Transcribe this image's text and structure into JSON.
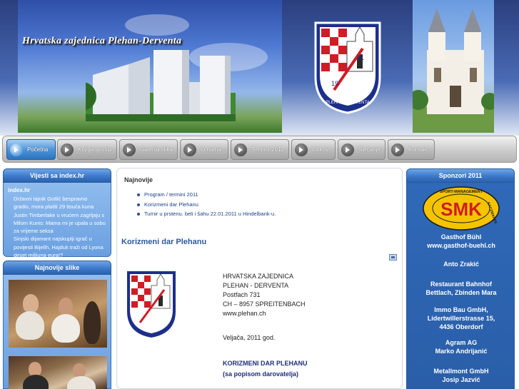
{
  "header": {
    "site_title": "Hrvatska zajednica Plehan-Derventa",
    "crest_year_left": "19",
    "crest_year_right": "91",
    "crest_text": "PLEHAN - DERVENTA"
  },
  "nav": {
    "items": [
      {
        "label": "Početna",
        "active": true
      },
      {
        "label": "Knjiga gostiju",
        "active": false
      },
      {
        "label": "Galerija slika",
        "active": false
      },
      {
        "label": "O nama",
        "active": false
      },
      {
        "label": "Termini 2011",
        "active": false
      },
      {
        "label": "Linkovi",
        "active": false
      },
      {
        "label": "Sjećanje",
        "active": false
      },
      {
        "label": "Kontakt",
        "active": false
      }
    ]
  },
  "left": {
    "news_title": "Vijesti sa index.hr",
    "news_source": "index.hr",
    "news_items": [
      "Državni tajnik Gotlić bespravno",
      "gradio, mora platiti 29 tisuća kuna",
      "Justin Timberlake u vrućem zagrljaju s",
      "Milom Kunis: Mama mi je upala u sobu",
      "za vrijeme seksa",
      "Sinjski dijamant najskuplji igrač u",
      "povijesti Bijelih, Hajduk traži od Lyona",
      "deset milijuna eura!?"
    ],
    "photos_title": "Najnovije slike"
  },
  "main": {
    "latest_title": "Najnovije",
    "latest_items": [
      "Program / termini 2011",
      "Korizmeni dar Plehanu",
      "Turnir u prstenu. beli i šahu 22.01.2011 u Hindelbank-u."
    ],
    "article_title": "Korizmeni dar Plehanu",
    "address_lines": [
      "HRVATSKA ZAJEDNICA",
      "PLEHAN  - DERVENTA",
      "Postfach 731",
      "CH –  8957 SPREITENBACH",
      "www.plehan.ch"
    ],
    "date": "Veljača, 2011 god.",
    "heading1": "KORIZMENI DAR PLEHANU",
    "heading2": "(sa popisom darovatelja)"
  },
  "right": {
    "sponsors_title": "Sponzori 2011",
    "smk_logo": {
      "text": "SMK",
      "ring_top": "SPORT-MANAGEMENT",
      "ring_side": "KACZMAREK"
    },
    "sponsors": [
      [
        "Gasthof Bühl",
        "www.gasthof-buehl.ch"
      ],
      [
        "Anto Zrakić"
      ],
      [
        "Restaurant Bahnhof",
        "Bettlach, Zbinden Mara"
      ],
      [
        "Immo Bau GmbH,",
        "Lidertwillerstrasse 15,",
        "4436 Oberdorf"
      ],
      [
        "Agram AG",
        "Marko Andrijanić"
      ],
      [
        "Metallmont GmbH",
        "Josip Jazvić"
      ]
    ]
  },
  "colors": {
    "nav_active": "#2a73c0",
    "panel_blue": "#3c79c9",
    "link_blue": "#1f3f88",
    "title_blue": "#2a5aa0"
  }
}
